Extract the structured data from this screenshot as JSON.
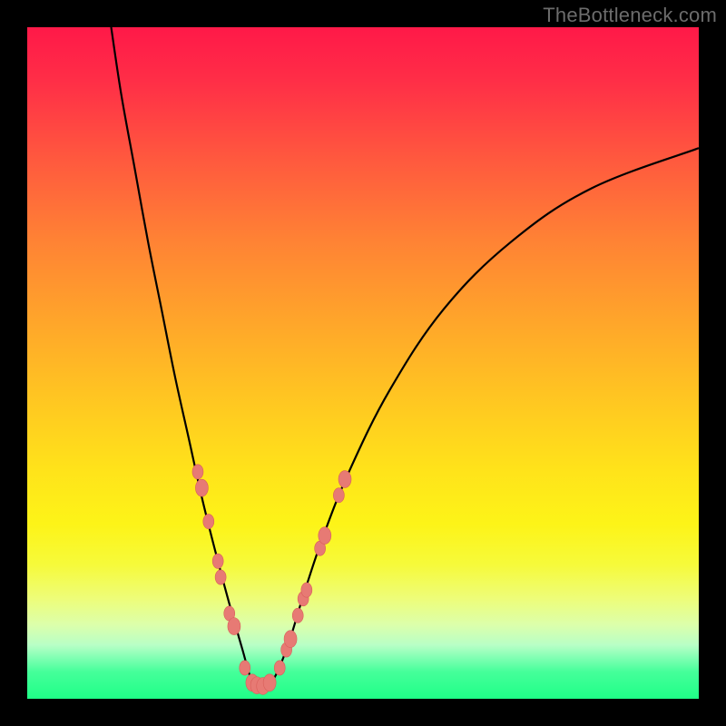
{
  "watermark": "TheBottleneck.com",
  "colors": {
    "frame": "#000000",
    "curve": "#000000",
    "marker_fill": "#e77a74",
    "marker_stroke": "#d95f5a"
  },
  "chart_data": {
    "type": "line",
    "title": "",
    "xlabel": "",
    "ylabel": "",
    "xlim": [
      0,
      100
    ],
    "ylim": [
      0,
      100
    ],
    "grid": false,
    "note": "Gradient background encodes bottleneck severity from red (high) at top to green (low) at bottom. V-shaped curve with minimum near x≈33, y≈0.",
    "series": [
      {
        "name": "bottleneck-curve",
        "x": [
          12.5,
          14,
          16,
          18,
          20,
          22,
          24,
          26,
          28,
          30,
          32,
          33.5,
          35,
          37,
          39,
          41,
          44,
          48,
          54,
          62,
          72,
          84,
          100
        ],
        "y": [
          100,
          90,
          79,
          68,
          58,
          48,
          39,
          30,
          22,
          14.5,
          7.5,
          2.5,
          1,
          3.5,
          8.5,
          15,
          24,
          34,
          46,
          58,
          68,
          76,
          82
        ]
      }
    ],
    "markers": [
      {
        "x": 25.4,
        "y": 33.8,
        "r": 6
      },
      {
        "x": 26.0,
        "y": 31.4,
        "r": 7
      },
      {
        "x": 27.0,
        "y": 26.4,
        "r": 6
      },
      {
        "x": 28.4,
        "y": 20.5,
        "r": 6
      },
      {
        "x": 28.8,
        "y": 18.1,
        "r": 6
      },
      {
        "x": 30.1,
        "y": 12.7,
        "r": 6
      },
      {
        "x": 30.8,
        "y": 10.8,
        "r": 7
      },
      {
        "x": 32.4,
        "y": 4.6,
        "r": 6
      },
      {
        "x": 33.5,
        "y": 2.4,
        "r": 7
      },
      {
        "x": 34.2,
        "y": 2.0,
        "r": 7
      },
      {
        "x": 35.1,
        "y": 1.9,
        "r": 7
      },
      {
        "x": 36.1,
        "y": 2.4,
        "r": 7
      },
      {
        "x": 37.6,
        "y": 4.6,
        "r": 6
      },
      {
        "x": 38.6,
        "y": 7.3,
        "r": 6
      },
      {
        "x": 39.2,
        "y": 8.9,
        "r": 7
      },
      {
        "x": 40.3,
        "y": 12.4,
        "r": 6
      },
      {
        "x": 41.1,
        "y": 14.9,
        "r": 6
      },
      {
        "x": 41.6,
        "y": 16.2,
        "r": 6
      },
      {
        "x": 43.6,
        "y": 22.4,
        "r": 6
      },
      {
        "x": 44.3,
        "y": 24.3,
        "r": 7
      },
      {
        "x": 46.4,
        "y": 30.3,
        "r": 6
      },
      {
        "x": 47.3,
        "y": 32.7,
        "r": 7
      }
    ]
  }
}
